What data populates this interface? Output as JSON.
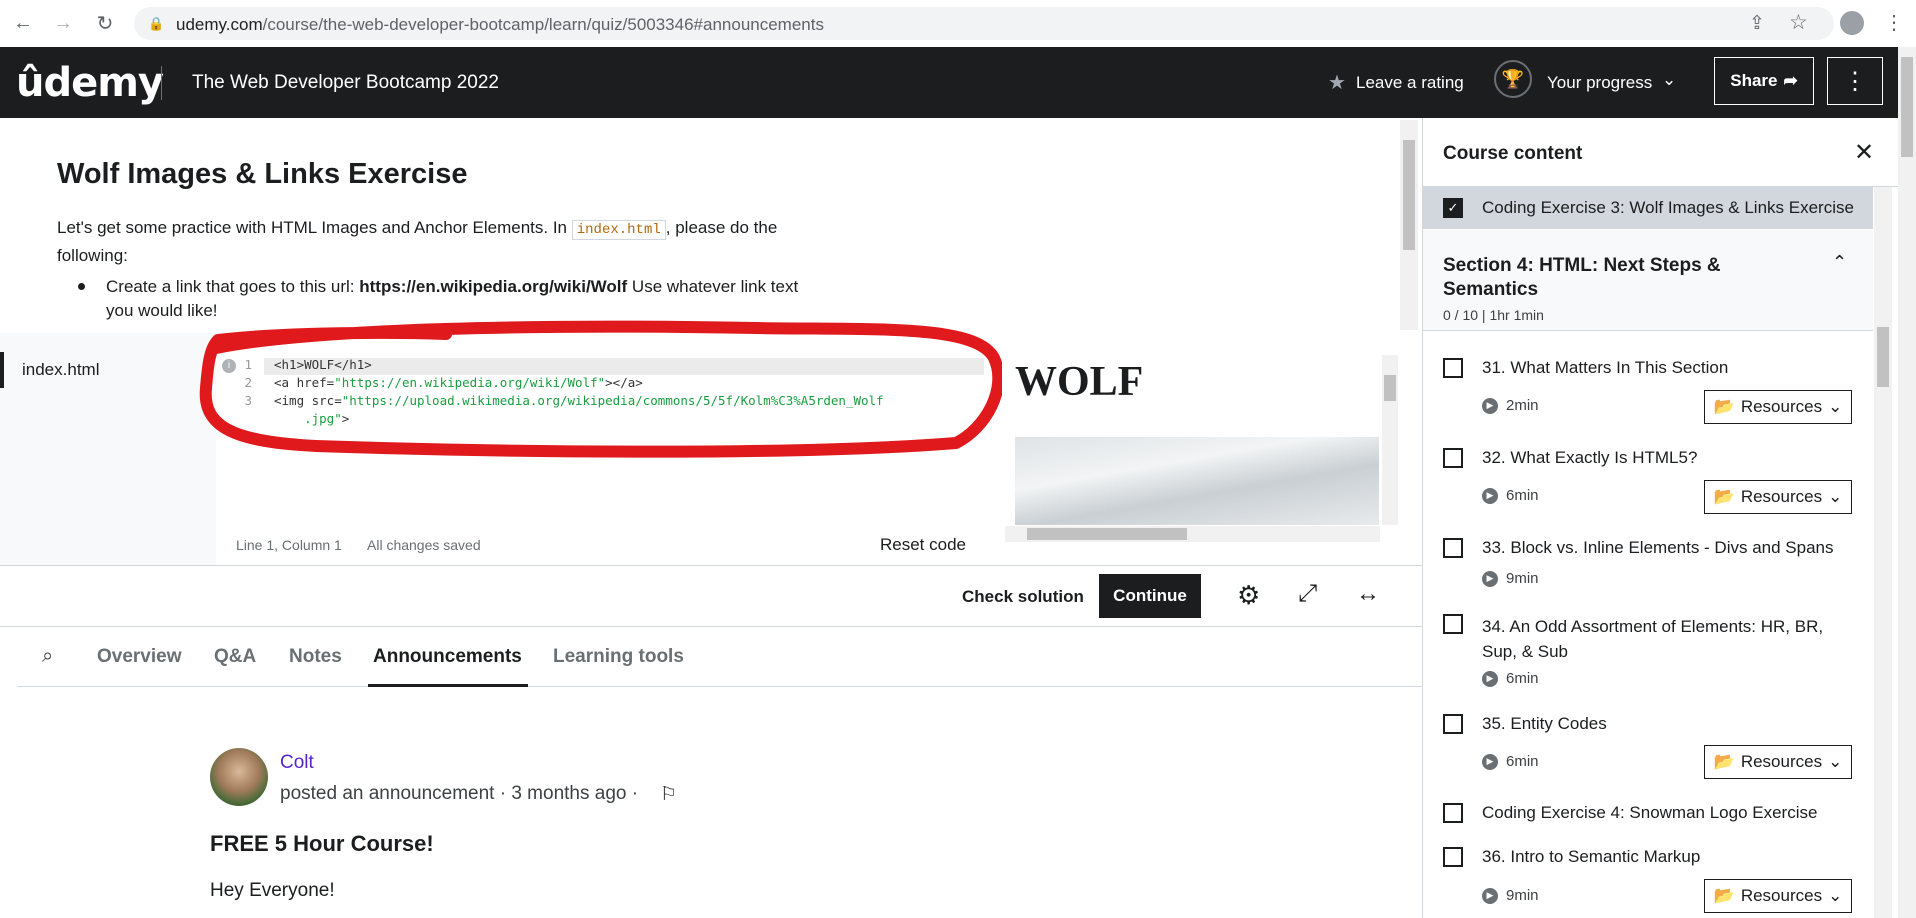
{
  "browser": {
    "url_domain": "udemy.com",
    "url_path": "/course/the-web-developer-bootcamp/learn/quiz/5003346#announcements"
  },
  "header": {
    "logo": "ûdemy",
    "course_title": "The Web Developer Bootcamp 2022",
    "rating_label": "Leave a rating",
    "progress_label": "Your progress",
    "share_label": "Share"
  },
  "exercise": {
    "title": "Wolf Images & Links Exercise",
    "intro": "Let's get some practice with HTML Images and Anchor Elements.  In ",
    "intro_code": "index.html",
    "intro_rest": ", please do the following:",
    "bullet_prefix": "Create a link that goes to this url: ",
    "bullet_url": "https://en.wikipedia.org/wiki/Wolf",
    "bullet_suffix": " Use whatever link text you would like!"
  },
  "editor": {
    "filename": "index.html",
    "lines": [
      {
        "n": "1",
        "parts": [
          [
            "tag",
            "<h1>WOLF</h1>"
          ]
        ]
      },
      {
        "n": "2",
        "parts": [
          [
            "tag",
            "<a href="
          ],
          [
            "str",
            "\"https://en.wikipedia.org/wiki/Wolf\""
          ],
          [
            "tag",
            "></a>"
          ]
        ]
      },
      {
        "n": "3",
        "parts": [
          [
            "tag",
            "<img src="
          ],
          [
            "str",
            "\"https://upload.wikimedia.org/wikipedia/commons/5/5f/Kolm%C3%A5rden_Wolf"
          ]
        ]
      },
      {
        "n": "",
        "parts": [
          [
            "str",
            "    .jpg\""
          ],
          [
            "tag",
            ">"
          ]
        ]
      }
    ],
    "cursor": "Line 1, Column 1",
    "save_status": "All changes saved",
    "reset_label": "Reset code",
    "preview_heading": "WOLF"
  },
  "actions": {
    "check_label": "Check solution",
    "continue_label": "Continue"
  },
  "tabs": [
    "Overview",
    "Q&A",
    "Notes",
    "Announcements",
    "Learning tools"
  ],
  "announcement": {
    "author": "Colt",
    "posted": "posted an announcement · 3 months ago ·",
    "title": "FREE 5 Hour Course!",
    "body": "Hey Everyone!"
  },
  "sidebar": {
    "title": "Course content",
    "current_item": "Coding Exercise 3: Wolf Images & Links Exercise",
    "section_title": "Section 4: HTML: Next Steps & Semantics",
    "section_meta": "0 / 10 | 1hr 1min",
    "resources_label": "Resources",
    "items": [
      {
        "title": "31. What Matters In This Section",
        "duration": "2min"
      },
      {
        "title": "32. What Exactly Is HTML5?",
        "duration": "6min"
      },
      {
        "title": "33. Block vs. Inline Elements - Divs and Spans",
        "duration": "9min"
      },
      {
        "title": "34. An Odd Assortment of Elements: HR, BR, Sup, & Sub",
        "duration": "6min"
      },
      {
        "title": "35. Entity Codes",
        "duration": "6min"
      },
      {
        "title": "Coding Exercise 4: Snowman Logo Exercise"
      },
      {
        "title": "36. Intro to Semantic Markup",
        "duration": "9min"
      }
    ]
  }
}
